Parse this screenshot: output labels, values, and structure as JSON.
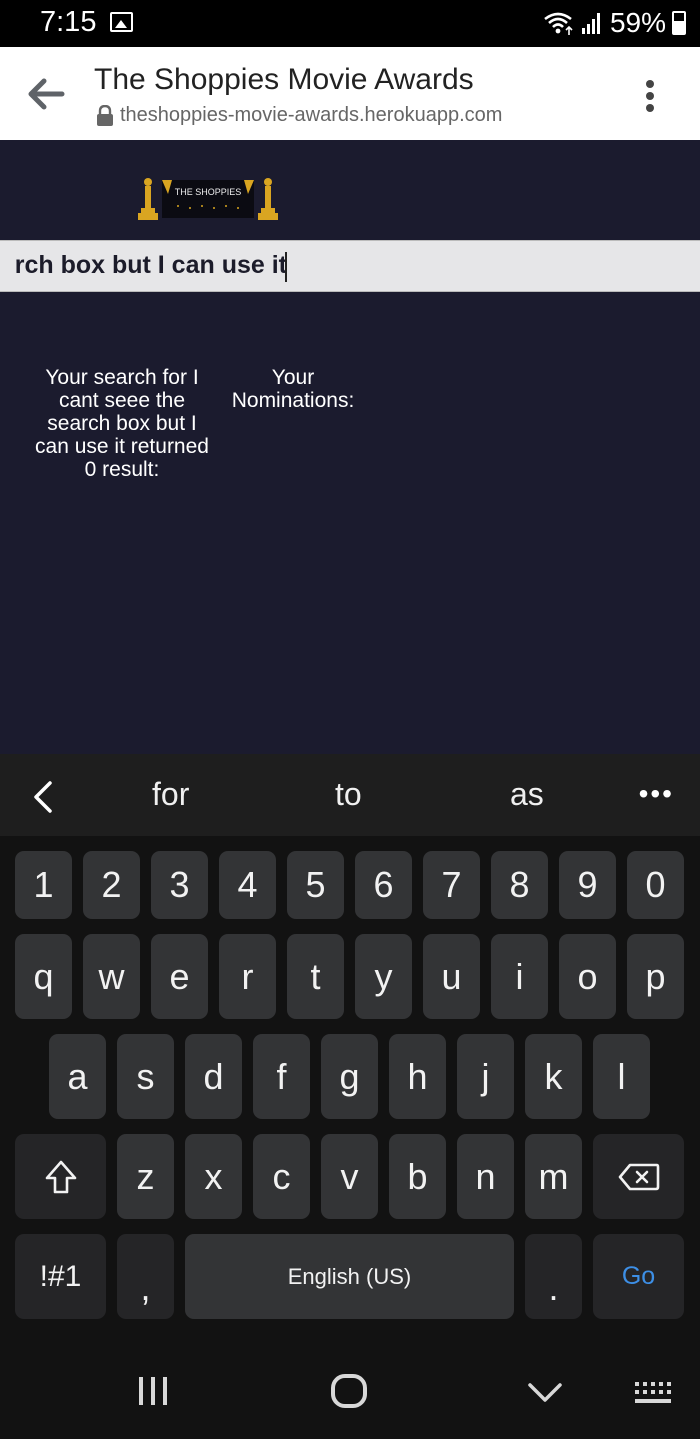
{
  "status_bar": {
    "time": "7:15",
    "battery": "59%",
    "icons": [
      "image-notification-icon",
      "wifi-icon",
      "signal-icon",
      "battery-icon"
    ]
  },
  "browser": {
    "title": "The Shoppies Movie Awards",
    "url": "theshoppies-movie-awards.herokuapp.com",
    "icons": [
      "back-arrow-icon",
      "lock-icon",
      "more-options-icon"
    ]
  },
  "page": {
    "logo_text": "THE SHOPPIES",
    "search_value": "rch box but I can use it",
    "result_text": "Your search for I cant seee the search box but I can use it returned 0 result:",
    "nominations_label": "Your Nominations:"
  },
  "keyboard": {
    "suggestions": [
      "for",
      "to",
      "as"
    ],
    "more_label": "•••",
    "row_numbers": [
      "1",
      "2",
      "3",
      "4",
      "5",
      "6",
      "7",
      "8",
      "9",
      "0"
    ],
    "row_top": [
      "q",
      "w",
      "e",
      "r",
      "t",
      "y",
      "u",
      "i",
      "o",
      "p"
    ],
    "row_middle": [
      "a",
      "s",
      "d",
      "f",
      "g",
      "h",
      "j",
      "k",
      "l"
    ],
    "row_bottom": [
      "z",
      "x",
      "c",
      "v",
      "b",
      "n",
      "m"
    ],
    "symbols_label": "!#1",
    "comma_label": ",",
    "space_label": "English (US)",
    "period_label": ".",
    "go_label": "Go"
  },
  "colors": {
    "page_background": "#1b1b2e",
    "search_box": "#e6e6e8",
    "go_accent": "#3d8fe6",
    "key": "#333436"
  }
}
